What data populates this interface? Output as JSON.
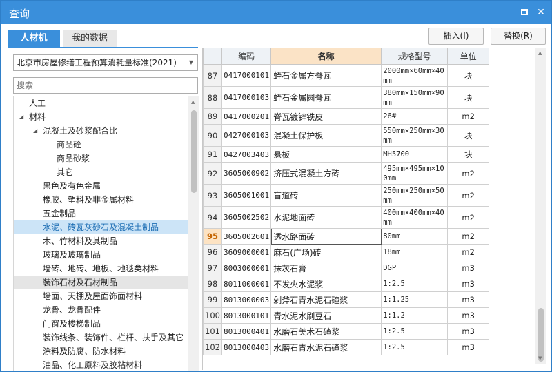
{
  "window": {
    "title": "查询",
    "minimize_glyph": "",
    "close_glyph": "✕"
  },
  "tabs": [
    {
      "label": "人材机",
      "active": true
    },
    {
      "label": "我的数据",
      "active": false
    }
  ],
  "actions": {
    "insert_label": "插入(I)",
    "replace_label": "替换(R)"
  },
  "standard_select": {
    "value": "北京市房屋修缮工程预算消耗量标准(2021)",
    "arrow": "▼"
  },
  "search": {
    "placeholder": "搜索",
    "value": ""
  },
  "tree": [
    {
      "label": "人工",
      "level": 1,
      "arrow": ""
    },
    {
      "label": "材料",
      "level": 1,
      "arrow": "◢"
    },
    {
      "label": "混凝土及砂浆配合比",
      "level": 2,
      "arrow": "◢"
    },
    {
      "label": "商品砼",
      "level": 3,
      "arrow": ""
    },
    {
      "label": "商品砂浆",
      "level": 3,
      "arrow": ""
    },
    {
      "label": "其它",
      "level": 3,
      "arrow": ""
    },
    {
      "label": "黑色及有色金属",
      "level": 2,
      "arrow": ""
    },
    {
      "label": "橡胶、塑料及非金属材料",
      "level": 2,
      "arrow": ""
    },
    {
      "label": "五金制品",
      "level": 2,
      "arrow": ""
    },
    {
      "label": "水泥、砖瓦灰砂石及混凝土制品",
      "level": 2,
      "arrow": "",
      "state": "selected"
    },
    {
      "label": "木、竹材料及其制品",
      "level": 2,
      "arrow": ""
    },
    {
      "label": "玻璃及玻璃制品",
      "level": 2,
      "arrow": ""
    },
    {
      "label": "墙砖、地砖、地板、地毯类材料",
      "level": 2,
      "arrow": ""
    },
    {
      "label": "装饰石材及石材制品",
      "level": 2,
      "arrow": "",
      "state": "hover"
    },
    {
      "label": "墙面、天棚及屋面饰面材料",
      "level": 2,
      "arrow": ""
    },
    {
      "label": "龙骨、龙骨配件",
      "level": 2,
      "arrow": ""
    },
    {
      "label": "门窗及楼梯制品",
      "level": 2,
      "arrow": ""
    },
    {
      "label": "装饰线条、装饰件、栏杆、扶手及其它",
      "level": 2,
      "arrow": ""
    },
    {
      "label": "涂料及防腐、防水材料",
      "level": 2,
      "arrow": ""
    },
    {
      "label": "油品、化工原料及胶粘材料",
      "level": 2,
      "arrow": ""
    }
  ],
  "grid": {
    "columns": [
      "",
      "编码",
      "名称",
      "规格型号",
      "单位"
    ],
    "active_column": 2,
    "rows": [
      {
        "no": "87",
        "code": "0417000101",
        "name": "蛭石金属方脊瓦",
        "spec": "2000mm×60mm×40mm",
        "unit": "块",
        "tall": true
      },
      {
        "no": "88",
        "code": "0417000103",
        "name": "蛭石金属圆脊瓦",
        "spec": "380mm×150mm×90mm",
        "unit": "块",
        "tall": true
      },
      {
        "no": "89",
        "code": "0417000201",
        "name": "脊瓦镀锌铁皮",
        "spec": "26#",
        "unit": "m2",
        "tall": false
      },
      {
        "no": "90",
        "code": "0427000103",
        "name": "混凝土保护板",
        "spec": "550mm×250mm×30mm",
        "unit": "块",
        "tall": true
      },
      {
        "no": "91",
        "code": "0427003403",
        "name": "悬板",
        "spec": "MH5700",
        "unit": "块",
        "tall": false
      },
      {
        "no": "92",
        "code": "3605000902",
        "name": "挤压式混凝土方砖",
        "spec": "495mm×495mm×100mm",
        "unit": "m2",
        "tall": true
      },
      {
        "no": "93",
        "code": "3605001001",
        "name": "盲道砖",
        "spec": "250mm×250mm×50mm",
        "unit": "m2",
        "tall": true
      },
      {
        "no": "94",
        "code": "3605002502",
        "name": "水泥地面砖",
        "spec": "400mm×400mm×40mm",
        "unit": "m2",
        "tall": true
      },
      {
        "no": "95",
        "code": "3605002601",
        "name": "透水路面砖",
        "spec": "80mm",
        "unit": "m2",
        "tall": false,
        "current": true
      },
      {
        "no": "96",
        "code": "3609000001",
        "name": "麻石(广场)砖",
        "spec": "18mm",
        "unit": "m2",
        "tall": false
      },
      {
        "no": "97",
        "code": "8003000001",
        "name": "抹灰石膏",
        "spec": "DGP",
        "unit": "m3",
        "tall": false
      },
      {
        "no": "98",
        "code": "8011000001",
        "name": "不发火水泥浆",
        "spec": "1:2.5",
        "unit": "m3",
        "tall": false
      },
      {
        "no": "99",
        "code": "8013000003",
        "name": "剁斧石青水泥石碴浆",
        "spec": "1:1.25",
        "unit": "m3",
        "tall": false
      },
      {
        "no": "100",
        "code": "8013000101",
        "name": "青水泥水刷豆石",
        "spec": "1:1.2",
        "unit": "m3",
        "tall": false
      },
      {
        "no": "101",
        "code": "8013000401",
        "name": "水磨石美术石碴浆",
        "spec": "1:2.5",
        "unit": "m3",
        "tall": false
      },
      {
        "no": "102",
        "code": "8013000403",
        "name": "水磨石青水泥石碴浆",
        "spec": "1:2.5",
        "unit": "m3",
        "tall": false
      }
    ]
  },
  "scrollbars": {
    "up_glyph": "▲",
    "down_glyph": "▼"
  }
}
